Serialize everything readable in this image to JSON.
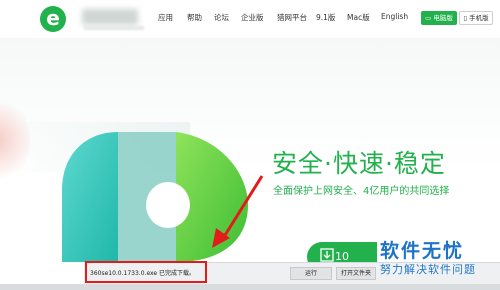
{
  "header": {
    "logo_letter": "e",
    "brand": "3 浏览器",
    "nav": [
      "应用",
      "帮助",
      "论坛",
      "企业版",
      "猎网平台",
      "9.1版",
      "Mac版",
      "English"
    ],
    "pc_button": "电脑版",
    "phone_button": "手机版"
  },
  "hero": {
    "slogan": "安全·快速·稳定",
    "subslogan": "全面保护上网安全、4亿用户的共同选择",
    "download_label": "10"
  },
  "download_bar": {
    "message": "360se10.0.1733.0.exe 已完成下载。",
    "run_label": "运行",
    "open_folder_label": "打开文件夹"
  },
  "watermark": {
    "title": "软件无忧",
    "subtitle": "努力解决软件问题"
  },
  "colors": {
    "brand_green": "#22b14c",
    "annotation_red": "#e31b1b",
    "watermark_blue": "#1e73c8"
  }
}
